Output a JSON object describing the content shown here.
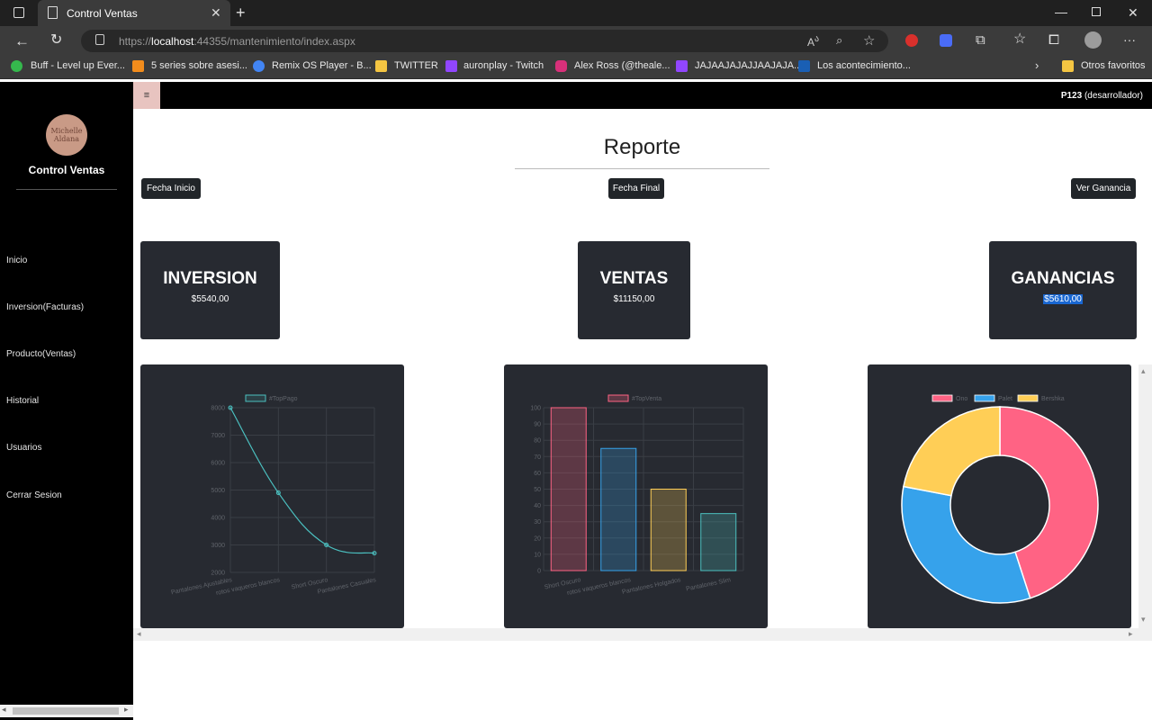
{
  "browser": {
    "tab_title": "Control Ventas",
    "url_protocol": "https://",
    "url_host": "localhost",
    "url_rest": ":44355/mantenimiento/index.aspx",
    "bookmarks": [
      {
        "label": "Buff - Level up Ever...",
        "color": "#35b84d"
      },
      {
        "label": "5 series sobre asesi...",
        "color": "#f28c1c"
      },
      {
        "label": "Remix OS Player - B...",
        "color": "#4285f4"
      },
      {
        "label": "TWITTER",
        "color": "#f4c542"
      },
      {
        "label": "auronplay - Twitch",
        "color": "#9146ff"
      },
      {
        "label": "Alex Ross (@theale...",
        "color": "#d8307a"
      },
      {
        "label": "JAJAAJAJAJJAAJAJA...",
        "color": "#9146ff"
      },
      {
        "label": "Los acontecimiento...",
        "color": "#1a5fb4"
      }
    ],
    "other_favorites": "Otros favoritos"
  },
  "sidebar": {
    "logo_text_1": "Michelle",
    "logo_text_2": "Aldana",
    "title": "Control Ventas",
    "items": [
      "Inicio",
      "Inversion(Facturas)",
      "Producto(Ventas)",
      "Historial",
      "Usuarios",
      "Cerrar Sesion"
    ]
  },
  "topbar": {
    "menu_icon": "≡",
    "user_code": "P123",
    "user_role": "(desarrollador)"
  },
  "report": {
    "title": "Reporte",
    "btn_start": "Fecha Inicio",
    "btn_end": "Fecha Final",
    "btn_profit": "Ver Ganancia"
  },
  "cards": {
    "inversion": {
      "label": "INVERSION",
      "value": "$5540,00"
    },
    "ventas": {
      "label": "VENTAS",
      "value": "$11150,00"
    },
    "ganancias": {
      "label": "GANANCIAS",
      "value": "$5610,00"
    }
  },
  "chart_data": [
    {
      "type": "line",
      "legend": "#TopPago",
      "color": "#4bc0c0",
      "categories": [
        "Pantalones Ajustables",
        "rotos vaqueros blancos",
        "Short Oscuro",
        "Pantalones Casuales"
      ],
      "values": [
        8000,
        4900,
        3000,
        2700
      ],
      "ylim": [
        2000,
        8000
      ],
      "yticks": [
        2000,
        3000,
        4000,
        5000,
        6000,
        7000,
        8000
      ]
    },
    {
      "type": "bar",
      "legend": "#TopVenta",
      "categories": [
        "Short Oscuro",
        "rotos vaqueros blancos",
        "Pantalones Holgados",
        "Pantalones Slim"
      ],
      "values": [
        100,
        75,
        50,
        35
      ],
      "colors": [
        "#ff6384",
        "#36a2eb",
        "#ffce56",
        "#4bc0c0"
      ],
      "ylim": [
        0,
        100
      ],
      "yticks": [
        0,
        10,
        20,
        30,
        40,
        50,
        60,
        70,
        80,
        90,
        100
      ]
    },
    {
      "type": "pie",
      "legend": [
        "Ono",
        "Palet",
        "Bershka"
      ],
      "values": [
        45,
        33,
        22
      ],
      "colors": [
        "#ff6384",
        "#36a2eb",
        "#ffce56"
      ]
    }
  ]
}
